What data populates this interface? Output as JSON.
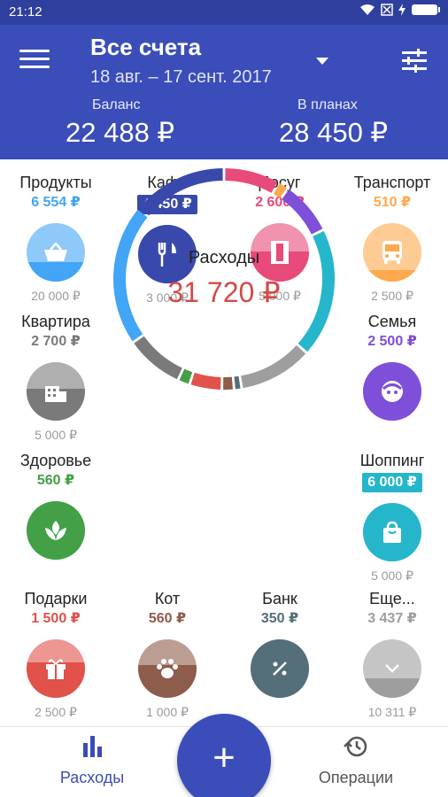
{
  "status": {
    "time": "21:12",
    "icons": [
      "wifi-icon",
      "sim-off-icon",
      "battery-icon"
    ]
  },
  "header": {
    "title": "Все счета",
    "period": "18 авг. – 17 сент. 2017",
    "balance_label": "Баланс",
    "balance_value": "22 488 ₽",
    "plans_label": "В планах",
    "plans_value": "28 450 ₽"
  },
  "categories": [
    {
      "name": "Продукты",
      "amount": "6 554 ₽",
      "plan": "20 000 ₽",
      "color": "#42a5f5",
      "fill_fraction": 0.33,
      "icon": "basket-icon"
    },
    {
      "name": "Кафе",
      "amount": "4 450 ₽",
      "plan": "3 000 ₽",
      "color": "#3949ab",
      "fill_fraction": 1.0,
      "icon": "cutlery-icon",
      "badge": true
    },
    {
      "name": "Досуг",
      "amount": "2 600 ₽",
      "plan": "5 000 ₽",
      "color": "#e84a7a",
      "fill_fraction": 0.52,
      "icon": "film-icon"
    },
    {
      "name": "Транспорт",
      "amount": "510 ₽",
      "plan": "2 500 ₽",
      "color": "#ffa94d",
      "fill_fraction": 0.2,
      "icon": "bus-icon"
    },
    {
      "name": "Квартира",
      "amount": "2 700 ₽",
      "plan": "5 000 ₽",
      "color": "#7a7a7a",
      "fill_fraction": 0.54,
      "icon": "building-icon"
    },
    {
      "name": "Семья",
      "amount": "2 500 ₽",
      "plan": "",
      "color": "#7e4fd8",
      "fill_fraction": 1.0,
      "icon": "face-icon"
    },
    {
      "name": "Здоровье",
      "amount": "560 ₽",
      "plan": "",
      "color": "#43a047",
      "fill_fraction": 1.0,
      "icon": "leaf-icon"
    },
    {
      "name": "Шоппинг",
      "amount": "6 000 ₽",
      "plan": "5 000 ₽",
      "color": "#26b6cc",
      "fill_fraction": 1.0,
      "icon": "bag-icon",
      "badge": true
    },
    {
      "name": "Подарки",
      "amount": "1 500 ₽",
      "plan": "2 500 ₽",
      "color": "#e0524a",
      "fill_fraction": 0.6,
      "icon": "gift-icon"
    },
    {
      "name": "Кот",
      "amount": "560 ₽",
      "plan": "1 000 ₽",
      "color": "#8d5c4a",
      "fill_fraction": 0.56,
      "icon": "paw-icon"
    },
    {
      "name": "Банк",
      "amount": "350 ₽",
      "plan": "",
      "color": "#546e7a",
      "fill_fraction": 1.0,
      "icon": "percent-icon"
    },
    {
      "name": "Еще...",
      "amount": "3 437 ₽",
      "plan": "10 311 ₽",
      "color": "#9e9e9e",
      "fill_fraction": 0.33,
      "icon": "chevron-down-icon"
    }
  ],
  "ring": {
    "label": "Расходы",
    "value": "31 720 ₽",
    "segments": [
      {
        "color": "#e84a7a",
        "value": 2600
      },
      {
        "color": "#ffa94d",
        "value": 510
      },
      {
        "color": "#7e4fd8",
        "value": 2500
      },
      {
        "color": "#26b6cc",
        "value": 6000
      },
      {
        "color": "#9e9e9e",
        "value": 3437
      },
      {
        "color": "#546e7a",
        "value": 350
      },
      {
        "color": "#8d5c4a",
        "value": 560
      },
      {
        "color": "#e0524a",
        "value": 1500
      },
      {
        "color": "#43a047",
        "value": 560
      },
      {
        "color": "#7a7a7a",
        "value": 2700
      },
      {
        "color": "#42a5f5",
        "value": 6554
      },
      {
        "color": "#3949ab",
        "value": 4450
      }
    ]
  },
  "tabs": {
    "expenses": "Расходы",
    "operations": "Операции"
  },
  "fab": {
    "label": "+"
  },
  "colors": {
    "primary": "#3b4db8",
    "expense": "#d24b45"
  }
}
